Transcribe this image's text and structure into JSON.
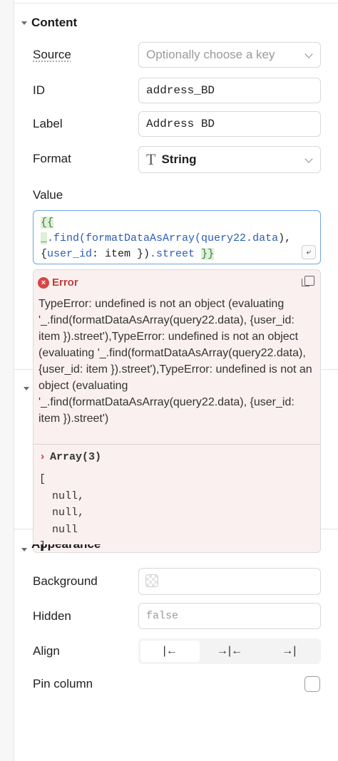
{
  "section": {
    "title": "Content",
    "appearance_title": "Appearance"
  },
  "labels": {
    "source": "Source",
    "id": "ID",
    "label": "Label",
    "format": "Format",
    "value": "Value",
    "background": "Background",
    "hidden": "Hidden",
    "align": "Align",
    "pin_column": "Pin column"
  },
  "fields": {
    "source_placeholder": "Optionally choose a key",
    "id_value": "address_BD",
    "label_value": "Address BD",
    "format_value": "String",
    "hidden_placeholder": "false"
  },
  "code": {
    "open_braces": "{{",
    "underscore": "_",
    "find": ".find(formatDataAsArray(query22.",
    "data": "data",
    "close1": "),",
    "brace_open": "{",
    "user_id": "user_id",
    "item_part": ": item })",
    "street": ".street",
    "close_braces": "}}"
  },
  "error": {
    "title": "Error",
    "message": "TypeError: undefined is not an object (evaluating '_.find(formatDataAsArray(query22.data), {user_id: item }).street'),TypeError: undefined is not an object (evaluating '_.find(formatDataAsArray(query22.data), {user_id: item }).street'),TypeError: undefined is not an object (evaluating '_.find(formatDataAsArray(query22.data), {user_id: item }).street')",
    "array_label": "Array(3)",
    "array_body": "[\n  null,\n  null,\n  null\n]"
  },
  "align_options": [
    "|←",
    "→|←",
    "→|"
  ],
  "icons": {
    "format_icon": "T",
    "error_icon": "×",
    "expand_caret": "›"
  },
  "colors": {
    "error": "#c13b3b",
    "focus_border": "#6ea7e0",
    "highlight": "#dff0d8"
  }
}
